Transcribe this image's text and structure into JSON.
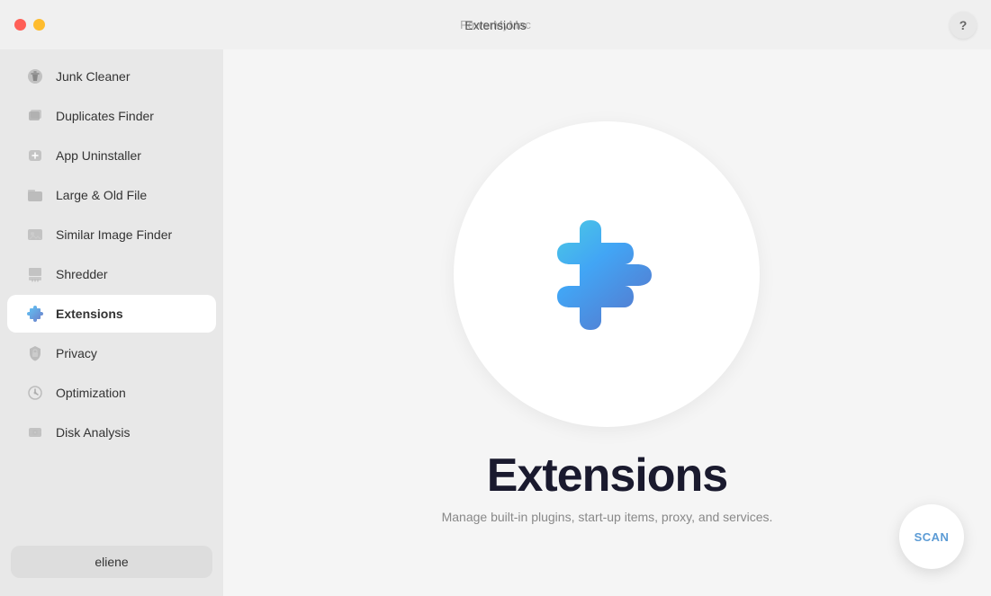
{
  "titlebar": {
    "app_name": "PowerMyMac",
    "center_title": "Extensions",
    "help_label": "?"
  },
  "sidebar": {
    "items": [
      {
        "id": "junk-cleaner",
        "label": "Junk Cleaner",
        "icon": "🧹",
        "active": false
      },
      {
        "id": "duplicates-finder",
        "label": "Duplicates Finder",
        "icon": "📁",
        "active": false
      },
      {
        "id": "app-uninstaller",
        "label": "App Uninstaller",
        "icon": "🗑",
        "active": false
      },
      {
        "id": "large-old-file",
        "label": "Large & Old File",
        "icon": "💼",
        "active": false
      },
      {
        "id": "similar-image-finder",
        "label": "Similar Image Finder",
        "icon": "🖼",
        "active": false
      },
      {
        "id": "shredder",
        "label": "Shredder",
        "icon": "📋",
        "active": false
      },
      {
        "id": "extensions",
        "label": "Extensions",
        "icon": "🧩",
        "active": true
      },
      {
        "id": "privacy",
        "label": "Privacy",
        "icon": "🔒",
        "active": false
      },
      {
        "id": "optimization",
        "label": "Optimization",
        "icon": "⚙",
        "active": false
      },
      {
        "id": "disk-analysis",
        "label": "Disk Analysis",
        "icon": "💾",
        "active": false
      }
    ],
    "user_label": "eliene"
  },
  "content": {
    "title": "Extensions",
    "subtitle": "Manage built-in plugins, start-up items, proxy, and services.",
    "scan_label": "SCAN"
  }
}
